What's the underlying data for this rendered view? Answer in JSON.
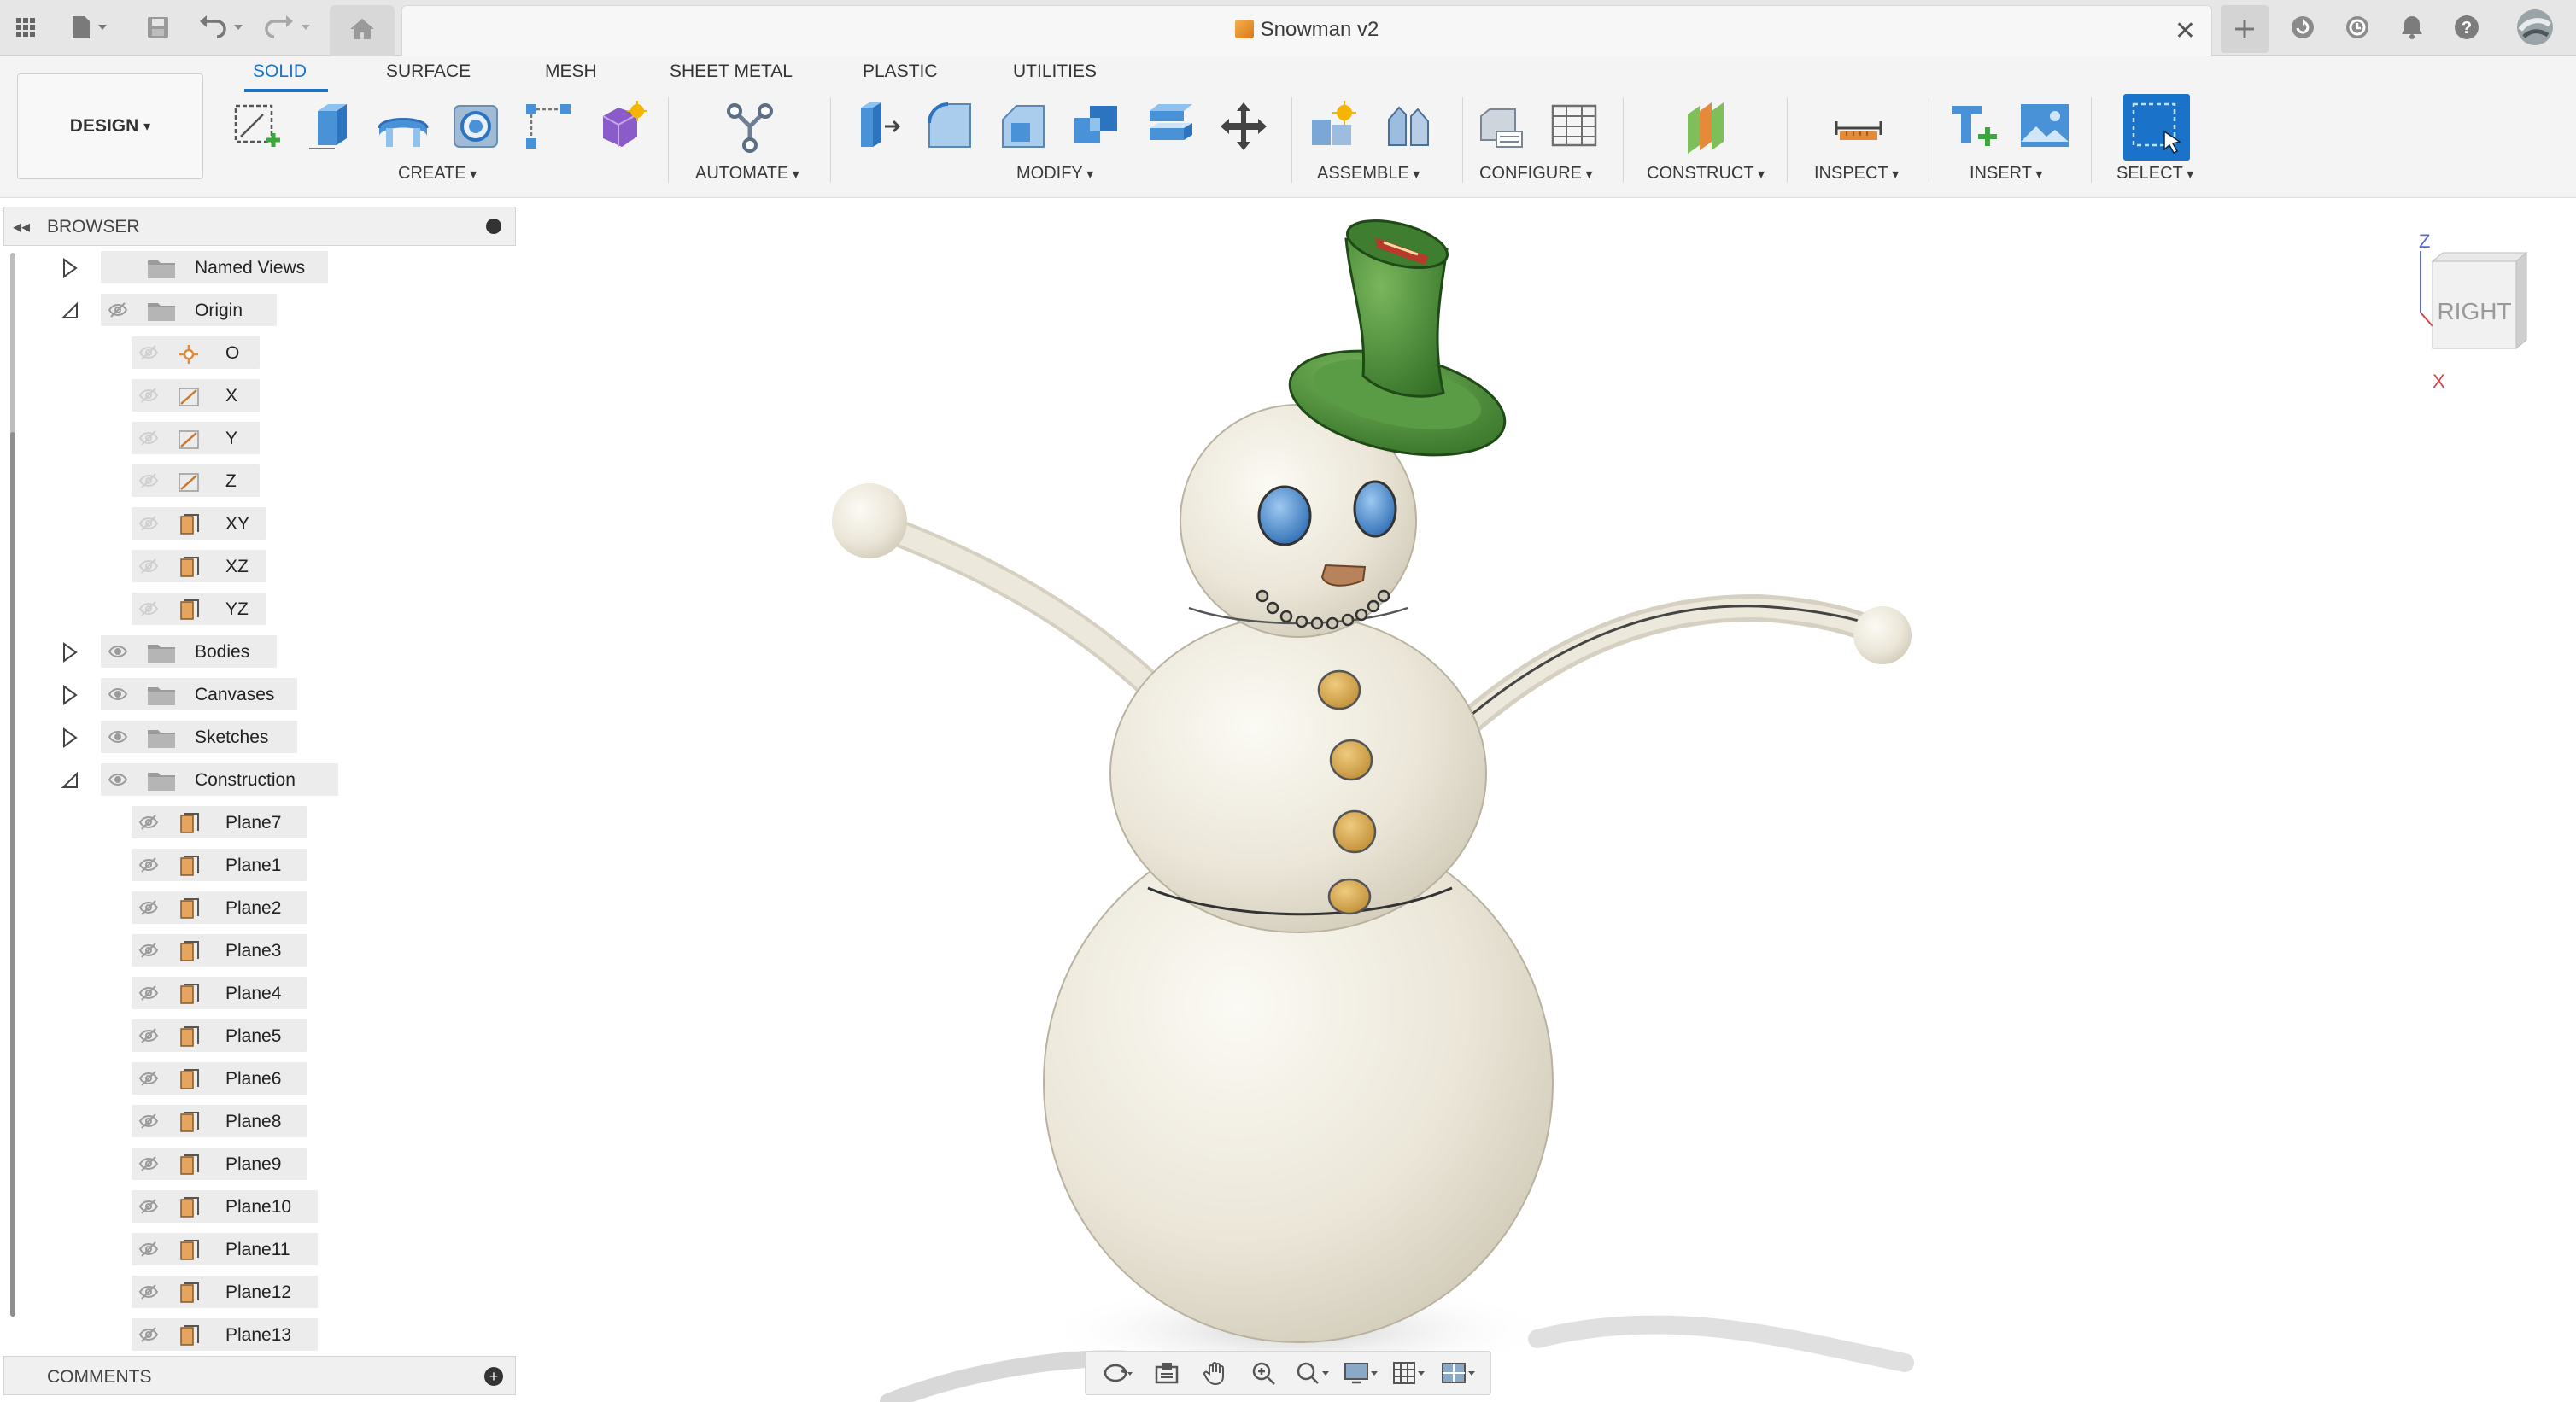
{
  "window": {
    "document_title": "Snowman v2",
    "icons": [
      "apps-grid-icon",
      "file-icon",
      "save-icon",
      "undo-icon",
      "redo-icon",
      "home-icon",
      "new-tab-icon",
      "extensions-icon",
      "job-status-icon",
      "notifications-icon",
      "help-icon",
      "user-avatar-icon"
    ]
  },
  "ribbon": {
    "workspace": "DESIGN",
    "tabs": [
      "SOLID",
      "SURFACE",
      "MESH",
      "SHEET METAL",
      "PLASTIC",
      "UTILITIES"
    ],
    "active_tab": "SOLID",
    "groups": {
      "create": "CREATE",
      "automate": "AUTOMATE",
      "modify": "MODIFY",
      "assemble": "ASSEMBLE",
      "configure": "CONFIGURE",
      "construct": "CONSTRUCT",
      "inspect": "INSPECT",
      "insert": "INSERT",
      "select": "SELECT"
    },
    "accent_color": "#1a73c9"
  },
  "browser": {
    "title": "BROWSER",
    "nodes": [
      {
        "label": "Named Views",
        "state": "collapsed"
      },
      {
        "label": "Origin",
        "state": "expanded",
        "visible": false
      },
      {
        "label": "O"
      },
      {
        "label": "X"
      },
      {
        "label": "Y"
      },
      {
        "label": "Z"
      },
      {
        "label": "XY"
      },
      {
        "label": "XZ"
      },
      {
        "label": "YZ"
      },
      {
        "label": "Bodies",
        "state": "collapsed",
        "visible": true
      },
      {
        "label": "Canvases",
        "state": "collapsed",
        "visible": true
      },
      {
        "label": "Sketches",
        "state": "collapsed",
        "visible": true
      },
      {
        "label": "Construction",
        "state": "expanded",
        "visible": true
      },
      {
        "label": "Plane7"
      },
      {
        "label": "Plane1"
      },
      {
        "label": "Plane2"
      },
      {
        "label": "Plane3"
      },
      {
        "label": "Plane4"
      },
      {
        "label": "Plane5"
      },
      {
        "label": "Plane6"
      },
      {
        "label": "Plane8"
      },
      {
        "label": "Plane9"
      },
      {
        "label": "Plane10"
      },
      {
        "label": "Plane11"
      },
      {
        "label": "Plane12"
      },
      {
        "label": "Plane13"
      }
    ]
  },
  "comments": {
    "title": "COMMENTS"
  },
  "viewcube": {
    "face": "RIGHT",
    "axis_z": "Z",
    "axis_x": "X"
  },
  "navbar": {
    "icons": [
      "orbit-icon",
      "look-at-icon",
      "pan-icon",
      "zoom-icon",
      "fit-icon",
      "display-settings-icon",
      "grid-settings-icon",
      "viewports-icon"
    ]
  },
  "model": {
    "body_color": "#ece8dc",
    "hat_color": "#4f8f3a",
    "eye_color": "#4a86c8",
    "button_color": "#d8a955",
    "nose_color": "#b8835a"
  }
}
